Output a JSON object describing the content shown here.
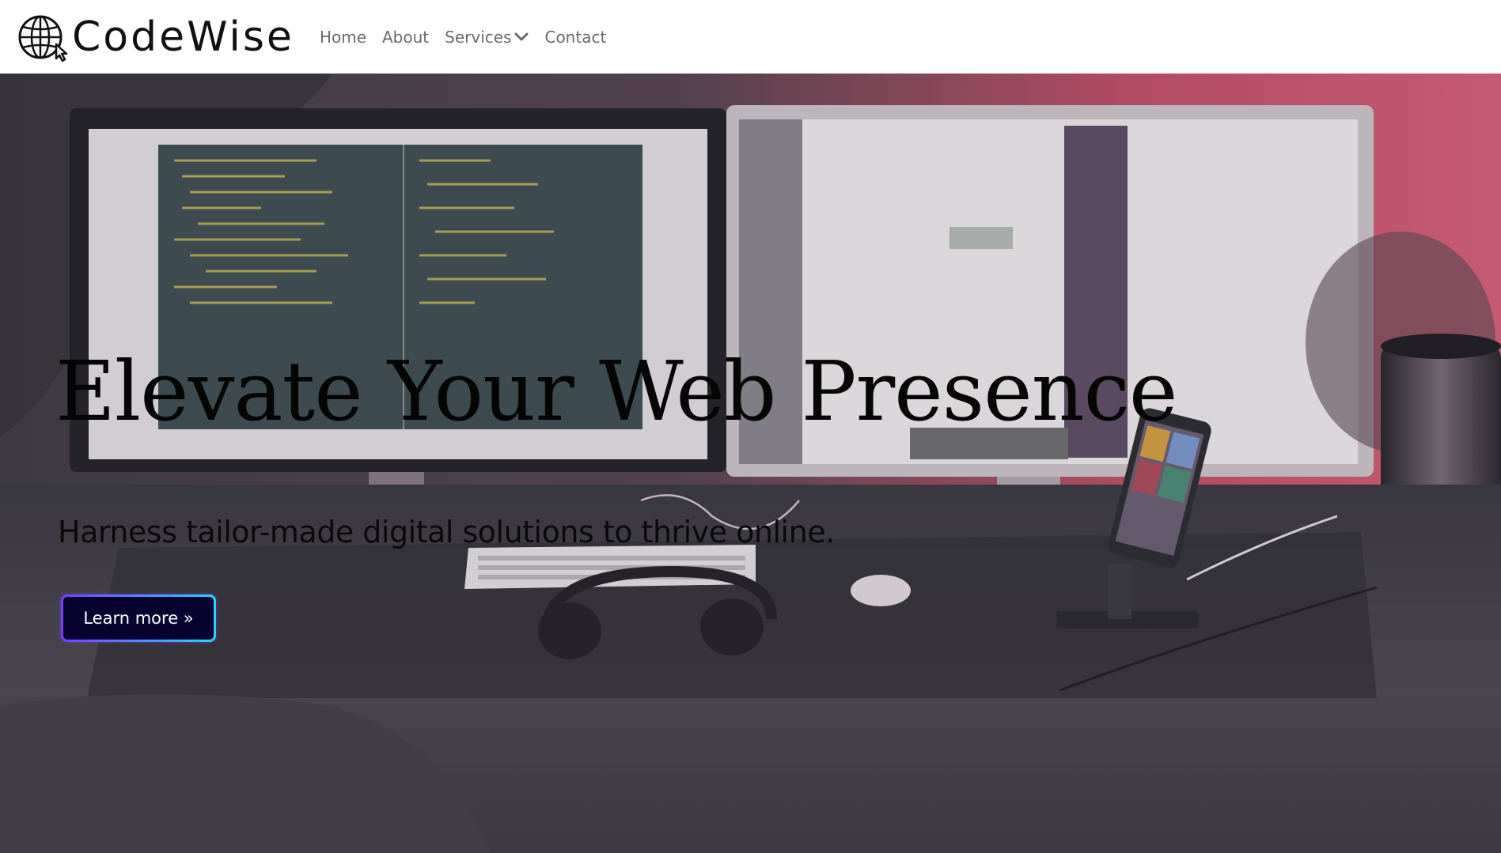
{
  "brand": {
    "name": "CodeWise",
    "logo_icon": "globe-cursor-icon"
  },
  "nav": {
    "items": [
      {
        "label": "Home"
      },
      {
        "label": "About"
      },
      {
        "label": "Services",
        "has_dropdown": true
      },
      {
        "label": "Contact"
      }
    ],
    "dropdown_icon": "chevron-down-icon"
  },
  "hero": {
    "title": "Elevate Your Web Presence",
    "subtitle": "Harness tailor-made digital solutions to thrive online.",
    "cta_label": "Learn more »",
    "background": "desk-workspace-photo"
  },
  "colors": {
    "nav_text": "#6b6b6b",
    "brand_text": "#111111",
    "cta_bg": "#07032e",
    "cta_border_start": "#7b3bff",
    "cta_border_end": "#2fd3ff",
    "wall_accent": "#d2506c"
  }
}
